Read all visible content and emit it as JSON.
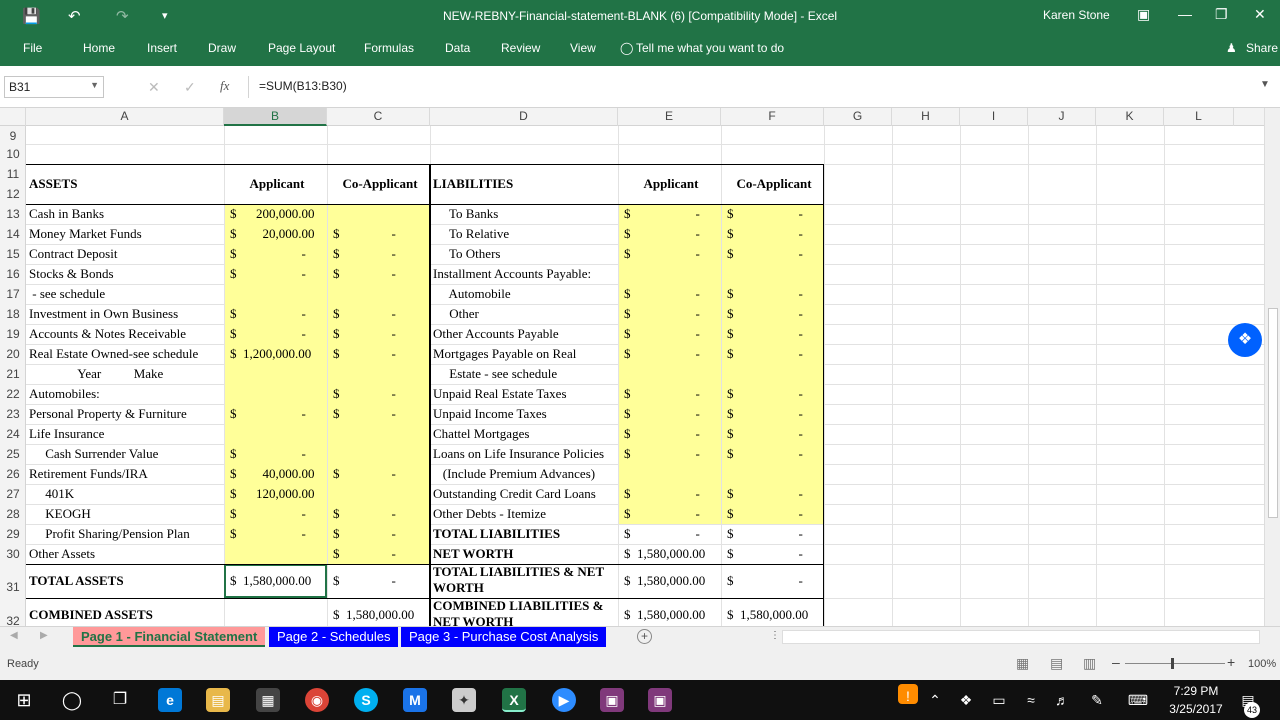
{
  "window": {
    "title": "NEW-REBNY-Financial-statement-BLANK (6)  [Compatibility Mode]  -  Excel",
    "user": "Karen Stone"
  },
  "ribbon": {
    "tabs": [
      "File",
      "Home",
      "Insert",
      "Draw",
      "Page Layout",
      "Formulas",
      "Data",
      "Review",
      "View"
    ],
    "tell_me": "Tell me what you want to do",
    "share": "Share"
  },
  "formula_bar": {
    "name_box": "B31",
    "formula": "=SUM(B13:B30)"
  },
  "columns": [
    "A",
    "B",
    "C",
    "D",
    "E",
    "F",
    "G",
    "H",
    "I",
    "J",
    "K",
    "L"
  ],
  "rows": [
    "9",
    "10",
    "11",
    "12",
    "13",
    "14",
    "15",
    "16",
    "17",
    "18",
    "19",
    "20",
    "21",
    "22",
    "23",
    "24",
    "25",
    "26",
    "27",
    "28",
    "29",
    "30",
    "31",
    "32"
  ],
  "sheet": {
    "headers": {
      "assets": "ASSETS",
      "applicant": "Applicant",
      "co_applicant": "Co-Applicant",
      "liabilities": "LIABILITIES"
    },
    "assets": [
      {
        "label": "Cash in Banks",
        "b": "$      200,000.00",
        "c": ""
      },
      {
        "label": "Money Market Funds",
        "b": "$        20,000.00",
        "c": "$                -"
      },
      {
        "label": "Contract Deposit",
        "b": "$                    -",
        "c": "$                -"
      },
      {
        "label": "Stocks & Bonds",
        "b": "$                    -",
        "c": "$                -"
      },
      {
        "label": " - see schedule",
        "b": "",
        "c": ""
      },
      {
        "label": "Investment in Own Business",
        "b": "$                    -",
        "c": "$                -"
      },
      {
        "label": "Accounts & Notes Receivable",
        "b": "$                    -",
        "c": "$                -"
      },
      {
        "label": "Real Estate Owned-see schedule",
        "b": "$  1,200,000.00",
        "c": "$                -"
      },
      {
        "label": "               Year          Make",
        "b": "",
        "c": ""
      },
      {
        "label": "Automobiles:",
        "b": "",
        "c": "$                -"
      },
      {
        "label": "Personal Property & Furniture",
        "b": "$                    -",
        "c": "$                -"
      },
      {
        "label": "Life Insurance",
        "b": "",
        "c": ""
      },
      {
        "label": "     Cash Surrender Value",
        "b": "$                    -",
        "c": ""
      },
      {
        "label": "Retirement Funds/IRA",
        "b": "$        40,000.00",
        "c": "$                -"
      },
      {
        "label": "     401K",
        "b": "$      120,000.00",
        "c": ""
      },
      {
        "label": "     KEOGH",
        "b": "$                    -",
        "c": "$                -"
      },
      {
        "label": "     Profit Sharing/Pension Plan",
        "b": "$                    -",
        "c": "$                -"
      },
      {
        "label": "Other Assets",
        "b": "",
        "c": "$                -"
      }
    ],
    "liabilities": [
      {
        "label": "     To Banks",
        "e": "$                    -",
        "f": "$                    -"
      },
      {
        "label": "     To Relative",
        "e": "$                    -",
        "f": "$                    -"
      },
      {
        "label": "     To Others",
        "e": "$                    -",
        "f": "$                    -"
      },
      {
        "label": "Installment Accounts Payable:",
        "e": "",
        "f": ""
      },
      {
        "label": "     Automobile",
        "e": "$                    -",
        "f": "$                    -"
      },
      {
        "label": "     Other",
        "e": "$                    -",
        "f": "$                    -"
      },
      {
        "label": "Other Accounts Payable",
        "e": "$                    -",
        "f": "$                    -"
      },
      {
        "label": "Mortgages Payable on Real",
        "e": "$                    -",
        "f": "$                    -"
      },
      {
        "label": "     Estate - see schedule",
        "e": "",
        "f": ""
      },
      {
        "label": "Unpaid Real Estate Taxes",
        "e": "$                    -",
        "f": "$                    -"
      },
      {
        "label": "Unpaid Income Taxes",
        "e": "$                    -",
        "f": "$                    -"
      },
      {
        "label": "Chattel Mortgages",
        "e": "$                    -",
        "f": "$                    -"
      },
      {
        "label": "Loans on Life Insurance Policies",
        "e": "$                    -",
        "f": "$                    -"
      },
      {
        "label": "   (Include Premium Advances)",
        "e": "",
        "f": ""
      },
      {
        "label": "Outstanding Credit Card Loans",
        "e": "$                    -",
        "f": "$                    -"
      },
      {
        "label": "Other Debts - Itemize",
        "e": "$                    -",
        "f": "$                    -"
      },
      {
        "label": "TOTAL LIABILITIES",
        "e": "$                    -",
        "f": "$                    -"
      },
      {
        "label": "NET WORTH",
        "e": "$  1,580,000.00",
        "f": "$                    -"
      }
    ],
    "totals": {
      "total_assets": "TOTAL ASSETS",
      "total_assets_b": "$  1,580,000.00",
      "total_assets_c": "$                -",
      "total_liab_nw": "TOTAL LIABILITIES & NET WORTH",
      "total_liab_nw_e": "$  1,580,000.00",
      "total_liab_nw_f": "$                    -",
      "combined_assets": "COMBINED ASSETS",
      "combined_assets_c": "$  1,580,000.00",
      "combined_liab": "COMBINED LIABILITIES & NET WORTH",
      "combined_liab_e": "$  1,580,000.00",
      "combined_liab_f": "$  1,580,000.00"
    }
  },
  "sheet_tabs": [
    "Page 1 - Financial Statement",
    "Page 2 - Schedules",
    "Page 3 - Purchase Cost Analysis"
  ],
  "status": {
    "ready": "Ready",
    "zoom": "100%"
  },
  "taskbar": {
    "time": "7:29 PM",
    "date": "3/25/2017",
    "notifications": "43"
  },
  "colors": {
    "excel_green": "#217346",
    "yellow": "#ffff99",
    "tab_blue": "#0000ff",
    "active_tab": "#ff9999"
  }
}
